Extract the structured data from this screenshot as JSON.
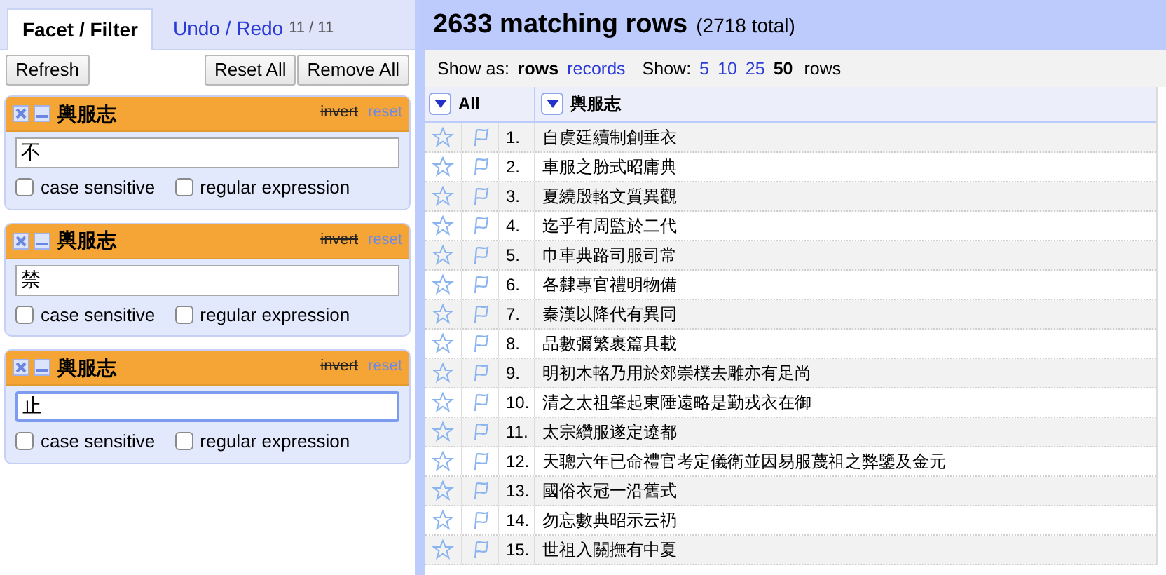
{
  "tabs": [
    {
      "label": "Facet / Filter",
      "selected": true
    },
    {
      "label": "Undo / Redo",
      "selected": false,
      "count": "11 / 11"
    }
  ],
  "buttons_left": [
    "Refresh"
  ],
  "buttons_right": [
    "Reset All",
    "Remove All"
  ],
  "facets": [
    {
      "title": "輿服志",
      "invert": "invert",
      "reset": "reset",
      "value": "不",
      "focused": false,
      "options": [
        {
          "label": "case sensitive",
          "checked": false
        },
        {
          "label": "regular expression",
          "checked": false
        }
      ]
    },
    {
      "title": "輿服志",
      "invert": "invert",
      "reset": "reset",
      "value": "禁",
      "focused": false,
      "options": [
        {
          "label": "case sensitive",
          "checked": false
        },
        {
          "label": "regular expression",
          "checked": false
        }
      ]
    },
    {
      "title": "輿服志",
      "invert": "invert",
      "reset": "reset",
      "value": "止",
      "focused": true,
      "options": [
        {
          "label": "case sensitive",
          "checked": false
        },
        {
          "label": "regular expression",
          "checked": false
        }
      ]
    }
  ],
  "summary": {
    "count": "2633 matching rows",
    "total": "(2718 total)"
  },
  "toolbar": {
    "show_as_label": "Show as:",
    "show_as": [
      {
        "label": "rows",
        "selected": true
      },
      {
        "label": "records",
        "selected": false
      }
    ],
    "show_label": "Show:",
    "page_sizes": [
      {
        "label": "5",
        "selected": false
      },
      {
        "label": "10",
        "selected": false
      },
      {
        "label": "25",
        "selected": false
      },
      {
        "label": "50",
        "selected": true
      }
    ],
    "rows_label": "rows"
  },
  "table": {
    "columns": [
      "All",
      "輿服志"
    ],
    "rows": [
      {
        "index": "1.",
        "value": "自虞廷續制創垂衣"
      },
      {
        "index": "2.",
        "value": "車服之肦式昭庸典"
      },
      {
        "index": "3.",
        "value": "夏繞殷輅文質異觀"
      },
      {
        "index": "4.",
        "value": "迄乎有周監於二代"
      },
      {
        "index": "5.",
        "value": "巾車典路司服司常"
      },
      {
        "index": "6.",
        "value": "各隸專官禮明物備"
      },
      {
        "index": "7.",
        "value": "秦漢以降代有異同"
      },
      {
        "index": "8.",
        "value": "品數彌繁裹篇具載"
      },
      {
        "index": "9.",
        "value": "明初木輅乃用於郊崇樸去雕亦有足尚"
      },
      {
        "index": "10.",
        "value": "清之太祖肇起東陲遠略是勤戎衣在御"
      },
      {
        "index": "11.",
        "value": "太宗纘服遂定遼都"
      },
      {
        "index": "12.",
        "value": "天聰六年已命禮官考定儀衛並因易服蔑祖之弊鑒及金元"
      },
      {
        "index": "13.",
        "value": "國俗衣冠一沿舊式"
      },
      {
        "index": "14.",
        "value": "勿忘數典昭示云礽"
      },
      {
        "index": "15.",
        "value": "世祖入關撫有中夏"
      }
    ]
  }
}
